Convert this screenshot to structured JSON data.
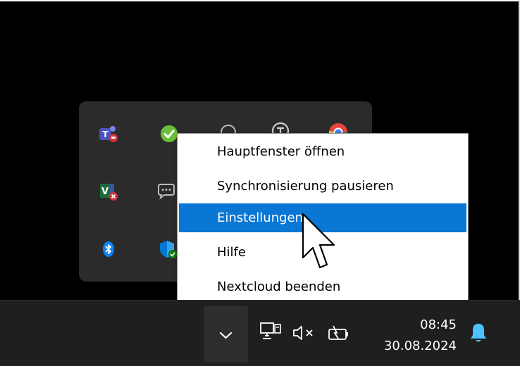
{
  "context_menu": {
    "items": [
      {
        "label": "Hauptfenster öffnen",
        "highlighted": false
      },
      {
        "label": "Synchronisierung pausieren",
        "highlighted": false
      },
      {
        "label": "Einstellungen",
        "highlighted": true
      },
      {
        "label": "Hilfe",
        "highlighted": false
      },
      {
        "label": "Nextcloud beenden",
        "highlighted": false
      }
    ]
  },
  "tray_icons": [
    "teams-icon",
    "checkmark-sync-icon",
    "webcam-icon",
    "vpn-icon",
    "chrome-icon",
    "visio-icon",
    "chat-icon",
    "bluetooth-icon",
    "defender-shield-icon"
  ],
  "taskbar": {
    "time": "08:45",
    "date": "30.08.2024"
  },
  "colors": {
    "highlight": "#0a77d4",
    "taskbar": "#1f1f1f",
    "flyout": "#2b2b2b",
    "bell": "#4cc2ff"
  }
}
